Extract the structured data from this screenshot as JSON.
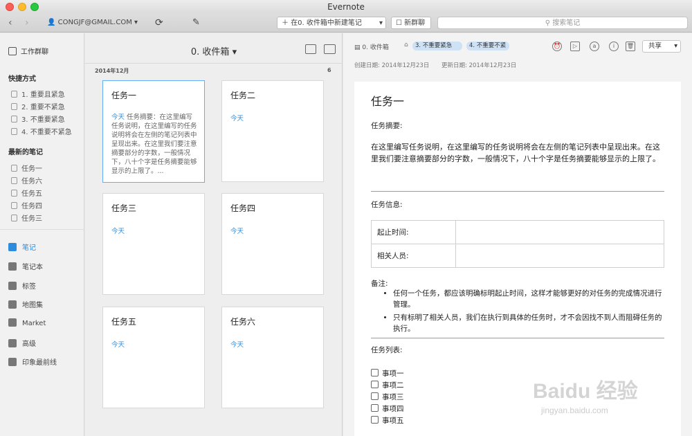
{
  "window": {
    "title": "Evernote"
  },
  "toolbar": {
    "account": "CONGJF@GMAIL.COM",
    "new_note": "在0. 收件箱中新建笔记",
    "new_chat": "新群聊",
    "search_placeholder": "搜索笔记"
  },
  "sidebar": {
    "work_chat": "工作群聊",
    "shortcuts_heading": "快捷方式",
    "shortcuts": [
      "1. 重要且紧急",
      "2. 重要不紧急",
      "3. 不重要紧急",
      "4. 不重要不紧急"
    ],
    "recent_heading": "最新的笔记",
    "recent": [
      "任务一",
      "任务六",
      "任务五",
      "任务四",
      "任务三"
    ],
    "main": [
      "笔记",
      "笔记本",
      "标签",
      "地图集",
      "Market",
      "高级",
      "印象最前线"
    ]
  },
  "notelist": {
    "title": "0. 收件箱",
    "month": "2014年12月",
    "count": "6",
    "cards": [
      {
        "title": "任务一",
        "date": "今天",
        "summary": "任务摘要：在这里编写任务说明，在这里编写的任务说明将会在左侧的笔记列表中呈现出来。在这里我们要注意摘要部分的字数，一般情况下，八十个字是任务摘要能够显示的上限了。..."
      },
      {
        "title": "任务二",
        "date": "今天"
      },
      {
        "title": "任务三",
        "date": "今天"
      },
      {
        "title": "任务四",
        "date": "今天"
      },
      {
        "title": "任务五",
        "date": "今天"
      },
      {
        "title": "任务六",
        "date": "今天"
      }
    ]
  },
  "editor": {
    "notebook": "0. 收件箱",
    "tags": [
      "3. 不重要紧急",
      "4. 不重要不紧"
    ],
    "share": "共享",
    "created": "创建日期: 2014年12月23日",
    "updated": "更新日期: 2014年12月23日",
    "doc": {
      "title": "任务一",
      "summary_heading": "任务摘要:",
      "summary_text": "在这里编写任务说明，在这里编写的任务说明将会在左侧的笔记列表中呈现出来。在这里我们要注意摘要部分的字数，一般情况下，八十个字是任务摘要能够显示的上限了。",
      "info_heading": "任务信息:",
      "info_rows": [
        "起止时间:",
        "相关人员:"
      ],
      "notes_heading": "备注:",
      "notes": [
        "任何一个任务，都应该明确标明起止时间，这样才能够更好的对任务的完成情况进行管理。",
        "只有标明了相关人员，我们在执行到具体的任务时，才不会因找不到人而阻碍任务的执行。"
      ],
      "todo_heading": "任务列表:",
      "todos": [
        "事项一",
        "事项二",
        "事项三",
        "事项四",
        "事项五"
      ]
    }
  },
  "watermark": {
    "brand": "Baidu 经验",
    "url": "jingyan.baidu.com"
  }
}
